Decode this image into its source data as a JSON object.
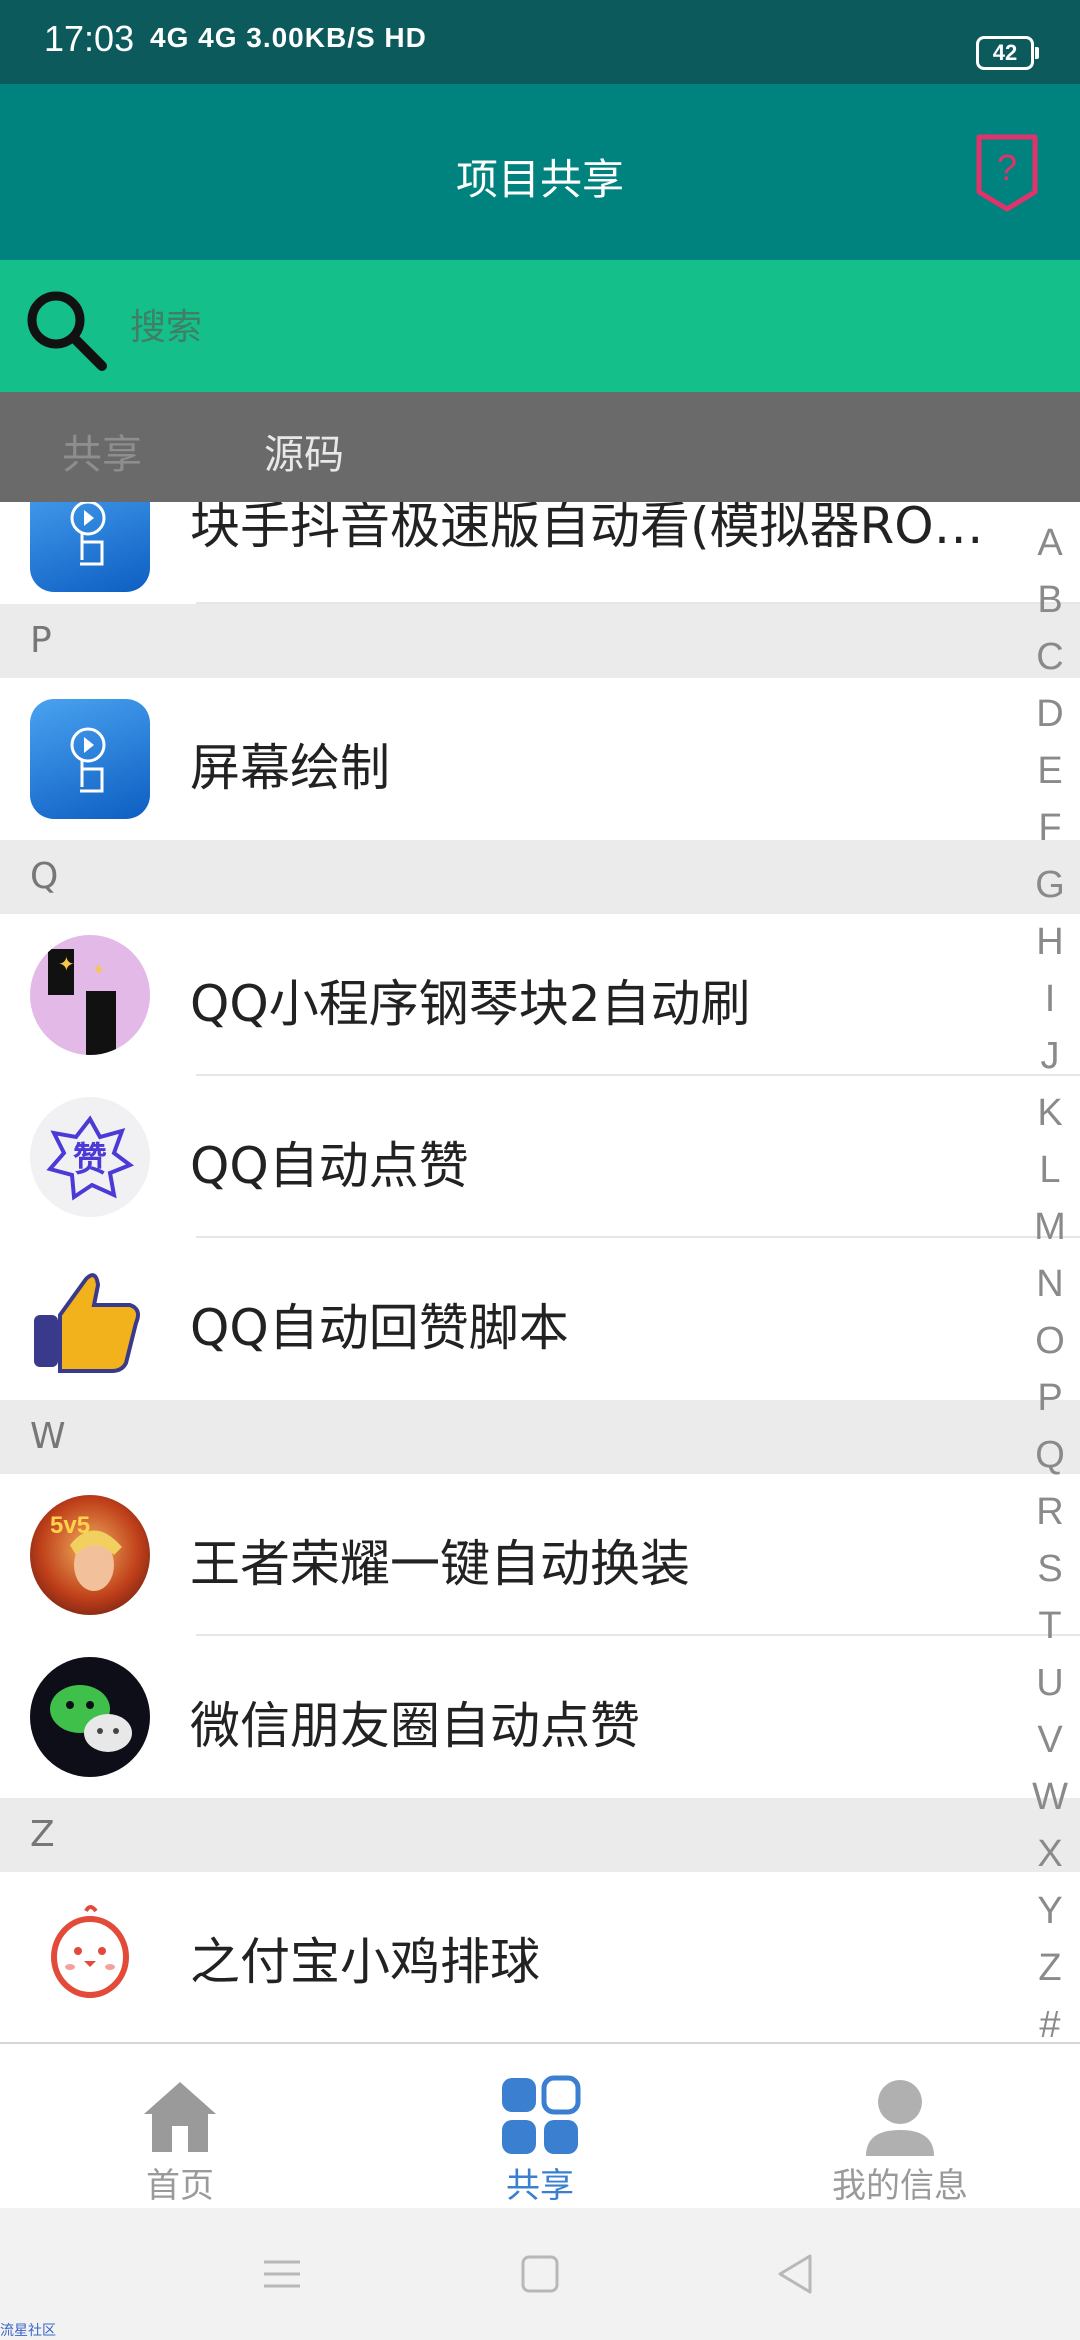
{
  "status_bar": {
    "time": "17:03",
    "network": "4G 4G 3.00KB/S HD",
    "battery": "42"
  },
  "app_bar": {
    "title": "项目共享",
    "help_icon": "help-question-icon"
  },
  "search": {
    "placeholder": "搜索",
    "icon": "search-icon"
  },
  "tabs": [
    {
      "label": "共享"
    },
    {
      "label": "源码"
    }
  ],
  "list": {
    "sections": [
      {
        "letter": "",
        "items": [
          {
            "label": "块手抖音极速版自动看(模拟器ROOT)",
            "icon": "touch-app-icon"
          }
        ]
      },
      {
        "letter": "P",
        "items": [
          {
            "label": "屏幕绘制",
            "icon": "touch-app-icon"
          }
        ]
      },
      {
        "letter": "Q",
        "items": [
          {
            "label": "QQ小程序钢琴块2自动刷",
            "icon": "piano-tiles-icon"
          },
          {
            "label": "QQ自动点赞",
            "icon": "like-badge-icon"
          },
          {
            "label": "QQ自动回赞脚本",
            "icon": "thumbs-up-icon"
          }
        ]
      },
      {
        "letter": "W",
        "items": [
          {
            "label": "王者荣耀一键自动换装",
            "icon": "game-hero-icon"
          },
          {
            "label": "微信朋友圈自动点赞",
            "icon": "wechat-icon"
          }
        ]
      },
      {
        "letter": "Z",
        "items": [
          {
            "label": "之付宝小鸡排球",
            "icon": "chick-icon"
          }
        ]
      }
    ]
  },
  "alpha_index": [
    "A",
    "B",
    "C",
    "D",
    "E",
    "F",
    "G",
    "H",
    "I",
    "J",
    "K",
    "L",
    "M",
    "N",
    "O",
    "P",
    "Q",
    "R",
    "S",
    "T",
    "U",
    "V",
    "W",
    "X",
    "Y",
    "Z",
    "#"
  ],
  "bottom_nav": [
    {
      "label": "首页",
      "icon": "home-icon",
      "active": false
    },
    {
      "label": "共享",
      "icon": "grid-icon",
      "active": true
    },
    {
      "label": "我的信息",
      "icon": "user-icon",
      "active": false
    }
  ],
  "colors": {
    "status_bar": "#0d5a5c",
    "app_bar": "#00837f",
    "search_bar": "#14bf8a",
    "tab_bar": "#6a6a6a",
    "nav_active": "#3a7fd0",
    "nav_inactive": "#9a9a9a"
  },
  "watermark": "流星社区"
}
